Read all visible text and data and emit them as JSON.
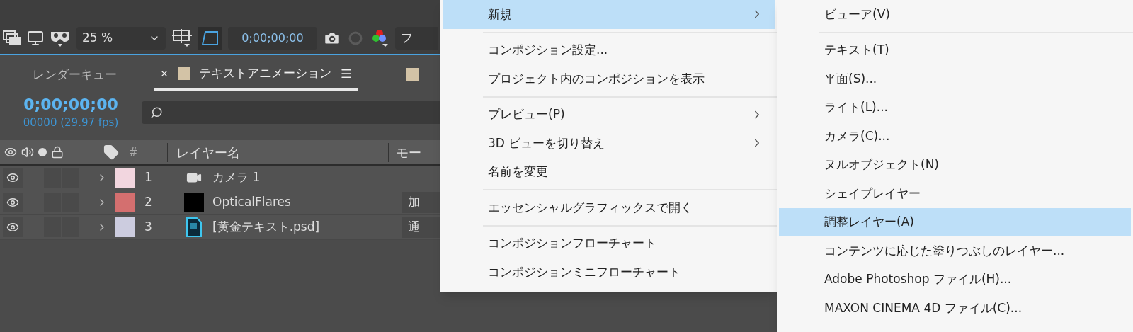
{
  "toolbar": {
    "zoom": "25 %",
    "timecode": "0;00;00;00",
    "cut_label": "フ"
  },
  "tabs": [
    {
      "label": "レンダーキュー",
      "selected": false
    },
    {
      "label": "テキストアニメーション",
      "selected": true,
      "color": "#d3c3a6"
    }
  ],
  "next_tab": {
    "color": "#d3c3a6"
  },
  "time": {
    "timecode": "0;00;00;00",
    "frames": "00000 (29.97 fps)"
  },
  "columns": {
    "number": "#",
    "name": "レイヤー名",
    "mode": "モー"
  },
  "layers": [
    {
      "number": "1",
      "name": "カメラ 1",
      "color": "#f2d6df",
      "kind": "camera",
      "visible": true
    },
    {
      "number": "2",
      "name": "OpticalFlares",
      "color": "#d46f6f",
      "kind": "solid",
      "visible": true,
      "mode": "加"
    },
    {
      "number": "3",
      "name": "[黄金テキスト.psd]",
      "color": "#ccccdf",
      "kind": "psd",
      "visible": true,
      "mode": "通"
    }
  ],
  "menu": [
    {
      "kind": "item",
      "label": "新規",
      "submenu": true,
      "selected": true
    },
    {
      "kind": "separator"
    },
    {
      "kind": "item",
      "label": "コンポジション設定...",
      "submenu": false,
      "selected": false
    },
    {
      "kind": "item",
      "label": "プロジェクト内のコンポジションを表示",
      "submenu": false,
      "selected": false
    },
    {
      "kind": "separator"
    },
    {
      "kind": "item",
      "label": "プレビュー(P)",
      "submenu": true,
      "selected": false
    },
    {
      "kind": "item",
      "label": "3D ビューを切り替え",
      "submenu": true,
      "selected": false
    },
    {
      "kind": "item",
      "label": "名前を変更",
      "submenu": false,
      "selected": false
    },
    {
      "kind": "separator"
    },
    {
      "kind": "item",
      "label": "エッセンシャルグラフィックスで開く",
      "submenu": false,
      "selected": false
    },
    {
      "kind": "separator"
    },
    {
      "kind": "item",
      "label": "コンポジションフローチャート",
      "submenu": false,
      "selected": false
    },
    {
      "kind": "item",
      "label": "コンポジションミニフローチャート",
      "submenu": false,
      "selected": false
    }
  ],
  "submenu": [
    {
      "kind": "item",
      "label": "ビューア(V)",
      "selected": false
    },
    {
      "kind": "separator"
    },
    {
      "kind": "item",
      "label": "テキスト(T)",
      "selected": false
    },
    {
      "kind": "item",
      "label": "平面(S)...",
      "selected": false
    },
    {
      "kind": "item",
      "label": "ライト(L)...",
      "selected": false
    },
    {
      "kind": "item",
      "label": "カメラ(C)...",
      "selected": false
    },
    {
      "kind": "item",
      "label": "ヌルオブジェクト(N)",
      "selected": false
    },
    {
      "kind": "item",
      "label": "シェイプレイヤー",
      "selected": false
    },
    {
      "kind": "item",
      "label": "調整レイヤー(A)",
      "selected": true
    },
    {
      "kind": "item",
      "label": "コンテンツに応じた塗りつぶしのレイヤー...",
      "selected": false
    },
    {
      "kind": "item",
      "label": "Adobe Photoshop ファイル(H)...",
      "selected": false
    },
    {
      "kind": "item",
      "label": "MAXON CINEMA 4D ファイル(C)...",
      "selected": false
    }
  ]
}
